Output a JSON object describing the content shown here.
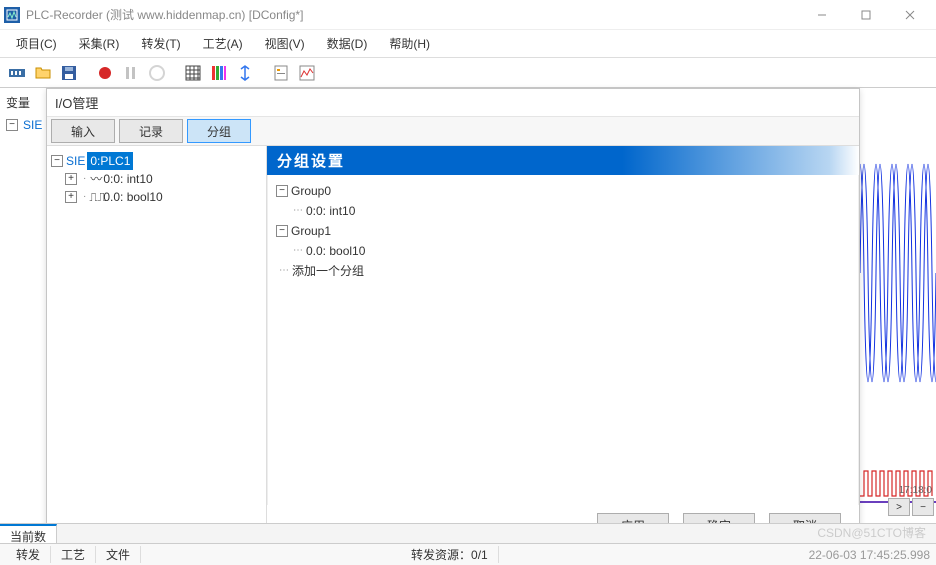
{
  "titlebar": {
    "title": "PLC-Recorder (测试 www.hiddenmap.cn) [DConfig*]"
  },
  "menu": [
    "项目(C)",
    "采集(R)",
    "转发(T)",
    "工艺(A)",
    "视图(V)",
    "数据(D)",
    "帮助(H)"
  ],
  "sidebar": {
    "label": "变量",
    "root": "SIE"
  },
  "dialog": {
    "title": "I/O管理",
    "tabs": {
      "input": "输入",
      "record": "记录",
      "group": "分组"
    },
    "left_tree": {
      "root": "SIE",
      "selected": "0:PLC1",
      "children": [
        {
          "icon": "sine",
          "label": "0:0: int10"
        },
        {
          "icon": "square",
          "label": "0.0: bool10"
        }
      ]
    },
    "right": {
      "header": "分组设置",
      "groups": [
        {
          "name": "Group0",
          "items": [
            "0:0: int10"
          ]
        },
        {
          "name": "Group1",
          "items": [
            "0.0: bool10"
          ]
        }
      ],
      "add_label": "添加一个分组"
    },
    "buttons": {
      "apply": "应用",
      "ok": "确定",
      "cancel": "取消"
    }
  },
  "chart": {
    "time_label": "17:18:0"
  },
  "bottom_tabs": {
    "current": "当前数",
    "forward": "转发",
    "tech": "工艺",
    "file": "文件"
  },
  "status": {
    "forward_source": "转发资源：0/1",
    "timestamp": "22-06-03 17:45:25.998"
  },
  "watermark": "CSDN@51CTO博客"
}
